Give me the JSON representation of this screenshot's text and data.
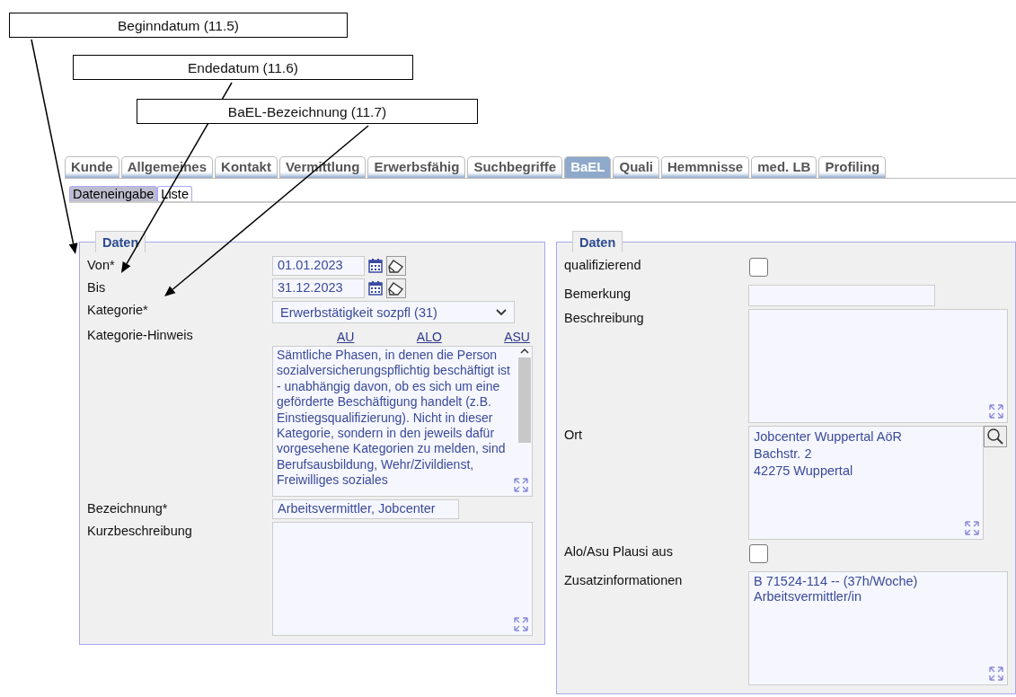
{
  "callouts": [
    {
      "text": "Beginndatum (11.5)"
    },
    {
      "text": "Endedatum (11.6)"
    },
    {
      "text": "BaEL-Bezeichnung (11.7)"
    }
  ],
  "tabs": [
    {
      "label": "Kunde",
      "selected": false
    },
    {
      "label": "Allgemeines",
      "selected": false
    },
    {
      "label": "Kontakt",
      "selected": false
    },
    {
      "label": "Vermittlung",
      "selected": false
    },
    {
      "label": "Erwerbsfähig",
      "selected": false
    },
    {
      "label": "Suchbegriffe",
      "selected": false
    },
    {
      "label": "BaEL",
      "selected": true
    },
    {
      "label": "Quali",
      "selected": false
    },
    {
      "label": "Hemmnisse",
      "selected": false
    },
    {
      "label": "med. LB",
      "selected": false
    },
    {
      "label": "Profiling",
      "selected": false
    }
  ],
  "subtabs": [
    {
      "label": "Dateneingabe",
      "selected": true
    },
    {
      "label": "Liste",
      "selected": false
    }
  ],
  "left_panel": {
    "legend": "Daten",
    "fields": [
      {
        "kind": "date",
        "label": "Von*",
        "value": "01.01.2023"
      },
      {
        "kind": "date",
        "label": "Bis",
        "value": "31.12.2023"
      },
      {
        "kind": "select",
        "label": "Kategorie*",
        "value": "Erwerbstätigkeit sozpfl (31)"
      },
      {
        "kind": "scrolltext",
        "label": "Kategorie-Hinweis",
        "links": [
          "AU",
          "ALO",
          "ASU"
        ],
        "value": "Sämtliche Phasen, in denen die Person sozialversicherungspflichtig beschäftigt ist - unabhängig davon, ob es sich um eine geförderte Beschäftigung handelt (z.B. Einstiegsqualifizierung). Nicht in dieser Kategorie, sondern in den jeweils dafür vorgesehene Kategorien zu melden, sind Berufsausbildung, Wehr/Zivildienst, Freiwilliges soziales"
      },
      {
        "kind": "text",
        "label": "Bezeichnung*",
        "value": "Arbeitsvermittler, Jobcenter"
      },
      {
        "kind": "textarea",
        "label": "Kurzbeschreibung"
      }
    ]
  },
  "right_panel": {
    "legend": "Daten",
    "fields": [
      {
        "kind": "checkbox",
        "label": "qualifizierend",
        "checked": false
      },
      {
        "kind": "text",
        "label": "Bemerkung"
      },
      {
        "kind": "textarea",
        "label": "Beschreibung"
      },
      {
        "kind": "address",
        "label": "Ort",
        "lines": [
          "Jobcenter Wuppertal AöR",
          "Bachstr. 2",
          "42275 Wuppertal"
        ]
      },
      {
        "kind": "checkbox",
        "label": "Alo/Asu Plausi aus",
        "checked": false
      },
      {
        "kind": "textarea",
        "label": "Zusatzinformationen",
        "lines": [
          "B 71524-114  --  (37h/Woche)",
          "Arbeitsvermittler/in"
        ]
      }
    ]
  }
}
